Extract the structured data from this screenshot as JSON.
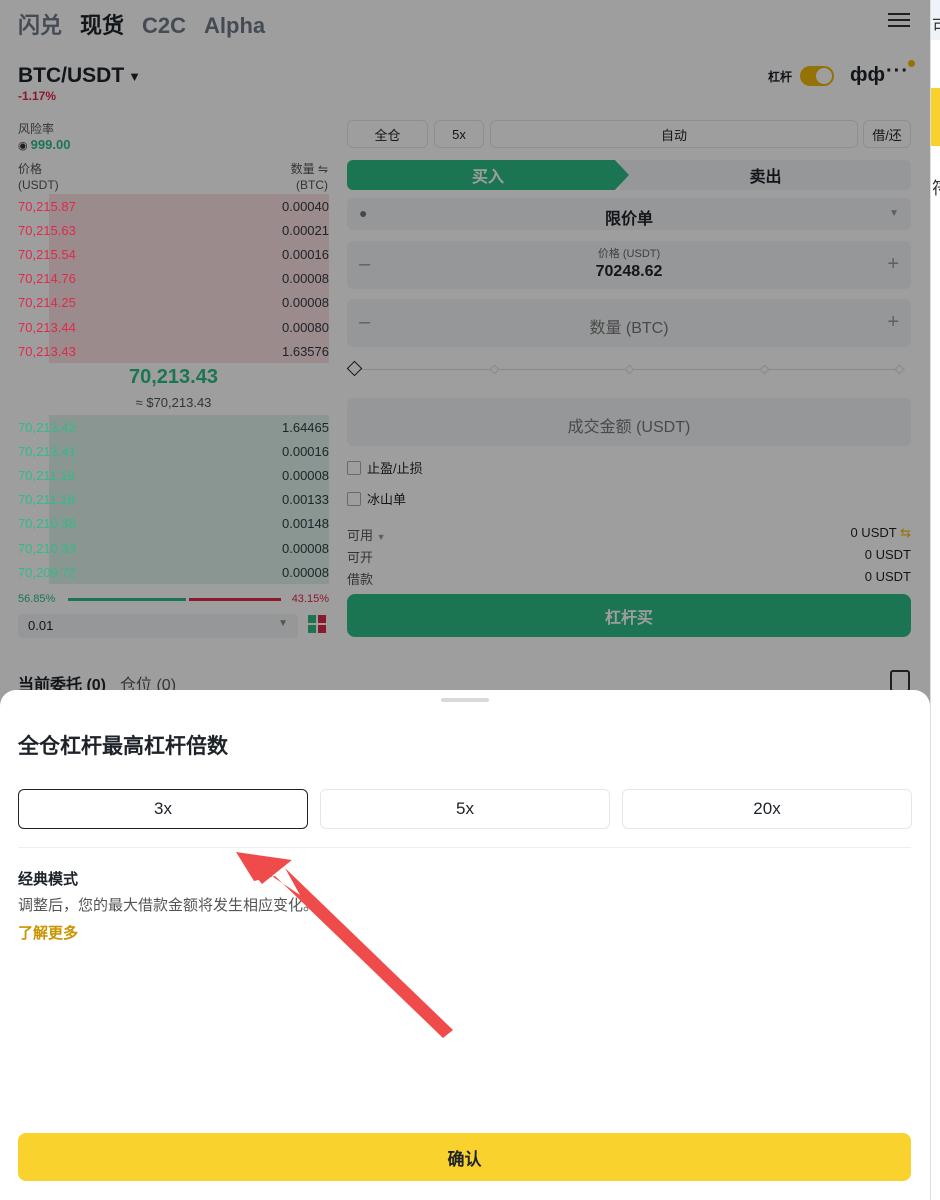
{
  "nav": {
    "tabs": [
      "闪兑",
      "现货",
      "C2C",
      "Alpha"
    ],
    "active": "现货"
  },
  "pair": {
    "symbol": "BTC/USDT",
    "change": "-1.17%",
    "leverage_label": "杠杆"
  },
  "risk": {
    "label": "风险率",
    "value": "999.00"
  },
  "orderbook": {
    "price_header": "价格",
    "price_unit": "(USDT)",
    "qty_header": "数量 ⇋",
    "qty_unit": "(BTC)",
    "asks": [
      {
        "price": "70,215.87",
        "qty": "0.00040",
        "depth": 0.9
      },
      {
        "price": "70,215.63",
        "qty": "0.00021",
        "depth": 0.9
      },
      {
        "price": "70,215.54",
        "qty": "0.00016",
        "depth": 0.9
      },
      {
        "price": "70,214.76",
        "qty": "0.00008",
        "depth": 0.9
      },
      {
        "price": "70,214.25",
        "qty": "0.00008",
        "depth": 0.9
      },
      {
        "price": "70,213.44",
        "qty": "0.00080",
        "depth": 0.9
      },
      {
        "price": "70,213.43",
        "qty": "1.63576",
        "depth": 0.9
      }
    ],
    "last_price": "70,213.43",
    "last_price_usd": "≈ $70,213.43",
    "bids": [
      {
        "price": "70,213.42",
        "qty": "1.64465",
        "depth": 0.9
      },
      {
        "price": "70,213.41",
        "qty": "0.00016",
        "depth": 0.9
      },
      {
        "price": "70,211.19",
        "qty": "0.00008",
        "depth": 0.9
      },
      {
        "price": "70,211.18",
        "qty": "0.00133",
        "depth": 0.9
      },
      {
        "price": "70,210.36",
        "qty": "0.00148",
        "depth": 0.9
      },
      {
        "price": "70,210.33",
        "qty": "0.00008",
        "depth": 0.9
      },
      {
        "price": "70,209.72",
        "qty": "0.00008",
        "depth": 0.9
      }
    ],
    "buy_ratio": "56.85%",
    "sell_ratio": "43.15%",
    "precision": "0.01"
  },
  "form": {
    "margin_mode": "全仓",
    "leverage": "5x",
    "auto": "自动",
    "borrow_repay": "借/还",
    "buy": "买入",
    "sell": "卖出",
    "order_type": "限价单",
    "price_label": "价格 (USDT)",
    "price_value": "70248.62",
    "qty_placeholder": "数量 (BTC)",
    "total_placeholder": "成交金额 (USDT)",
    "tp_sl": "止盈/止损",
    "iceberg": "冰山单",
    "available_label": "可用",
    "available_value": "0 USDT",
    "openable_label": "可开",
    "openable_value": "0 USDT",
    "borrow_label": "借款",
    "borrow_value": "0 USDT",
    "submit": "杠杆买"
  },
  "bottom_tabs": {
    "orders": "当前委托 (0)",
    "positions": "仓位 (0)"
  },
  "sheet": {
    "title": "全仓杠杆最高杠杆倍数",
    "options": [
      "3x",
      "5x",
      "20x"
    ],
    "selected": "3x",
    "mode_title": "经典模式",
    "mode_desc": "调整后，您的最大借款金额将发生相应变化。",
    "learn_more": "了解更多",
    "confirm": "确认"
  },
  "right_strip": {
    "text1": "可用",
    "text2": "符"
  },
  "colors": {
    "green": "#2ebd85",
    "red": "#e0294a",
    "yellow": "#f9d22e",
    "accent": "#f0b90b",
    "arrow": "#f04b4b"
  },
  "icons": [
    "menu-icon",
    "kline-icon",
    "more-icon",
    "info-icon",
    "history-icon",
    "swap-icon",
    "book-mode-icon"
  ]
}
